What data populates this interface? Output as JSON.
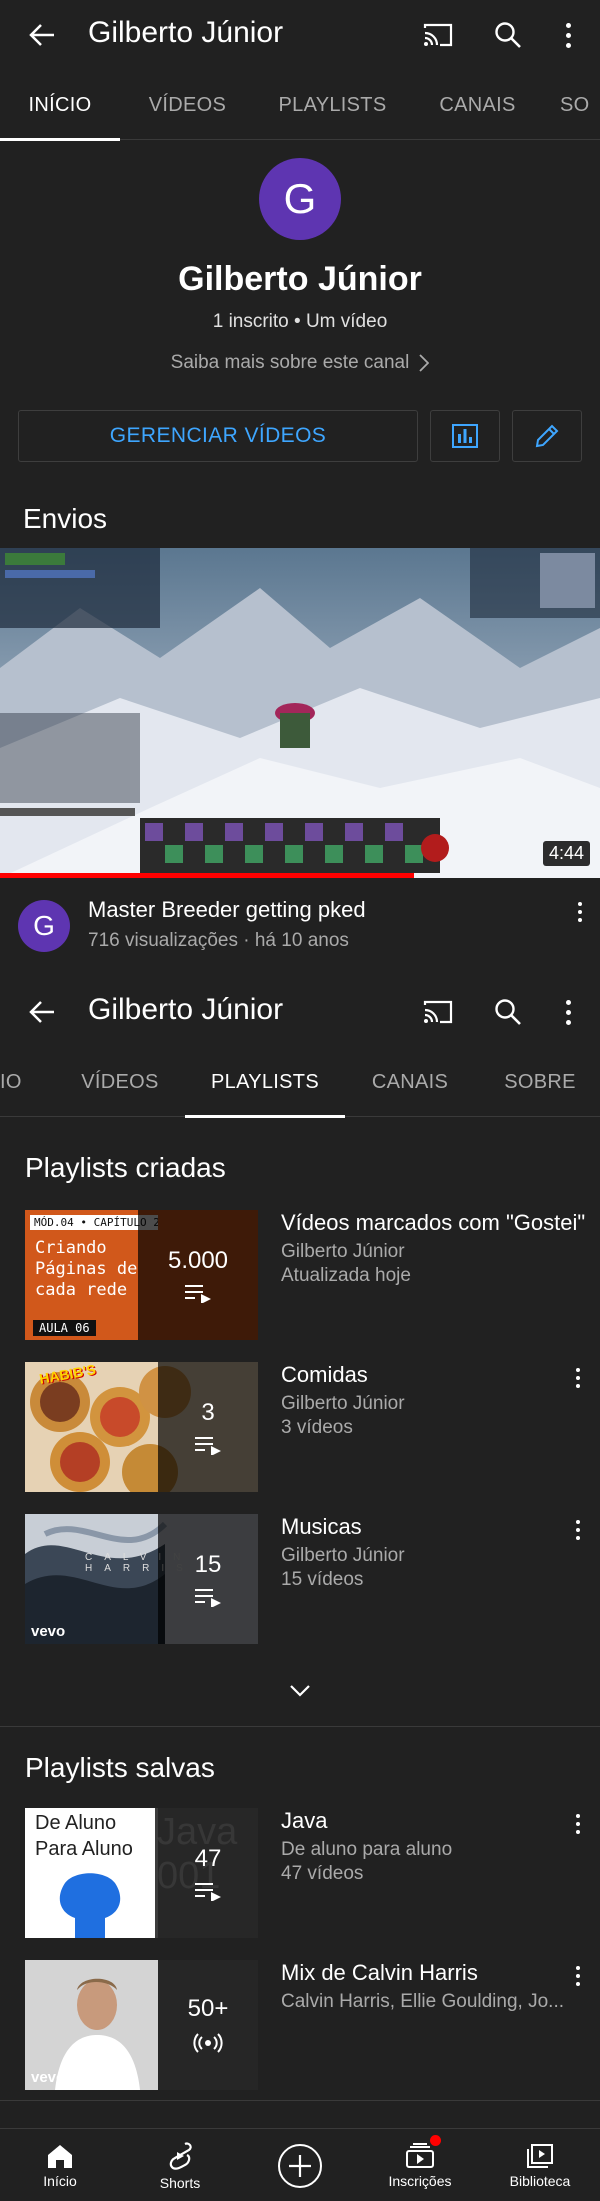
{
  "screen1": {
    "header": {
      "title": "Gilberto Júnior"
    },
    "tabs": [
      {
        "label": "INÍCIO",
        "active": true
      },
      {
        "label": "VÍDEOS",
        "active": false
      },
      {
        "label": "PLAYLISTS",
        "active": false
      },
      {
        "label": "CANAIS",
        "active": false
      },
      {
        "label": "SO",
        "active": false
      }
    ],
    "channel": {
      "avatar_letter": "G",
      "name": "Gilberto Júnior",
      "stats": "1 inscrito • Um vídeo",
      "more_link": "Saiba mais sobre este canal"
    },
    "manage_button": "GERENCIAR VÍDEOS",
    "uploads": {
      "heading": "Envios",
      "video": {
        "duration": "4:44",
        "title": "Master Breeder getting pked",
        "meta": "716 visualizações · há 10 anos",
        "avatar_letter": "G",
        "watched_fraction": 0.69
      }
    }
  },
  "screen2": {
    "header": {
      "title": "Gilberto Júnior"
    },
    "tabs": [
      {
        "label": "IO",
        "active": false
      },
      {
        "label": "VÍDEOS",
        "active": false
      },
      {
        "label": "PLAYLISTS",
        "active": true
      },
      {
        "label": "CANAIS",
        "active": false
      },
      {
        "label": "SOBRE",
        "active": false
      }
    ],
    "created": {
      "heading": "Playlists criadas",
      "items": [
        {
          "title": "Vídeos marcados com \"Gostei\"",
          "owner": "Gilberto Júnior",
          "detail": "Atualizada hoje",
          "count": "5.000",
          "thumb": {
            "badge": "MÓD.04 • CAPÍTULO 2",
            "line1": "Criando",
            "line2": "Páginas de",
            "line3": "cada rede",
            "footer": "AULA 06"
          }
        },
        {
          "title": "Comidas",
          "owner": "Gilberto Júnior",
          "detail": "3 vídeos",
          "count": "3",
          "thumb": {
            "brand": "HABIB'S"
          }
        },
        {
          "title": "Musicas",
          "owner": "Gilberto Júnior",
          "detail": "15 vídeos",
          "count": "15",
          "thumb": {
            "text": "CALVIN HARRIS",
            "logo": "vevo"
          }
        }
      ]
    },
    "saved": {
      "heading": "Playlists salvas",
      "items": [
        {
          "title": "Java",
          "owner": "De aluno para aluno",
          "detail": "47 vídeos",
          "count": "47",
          "thumb": {
            "line1": "De Aluno",
            "line2": "Para Aluno",
            "bg_text1": "Java",
            "bg_text2": "001"
          }
        },
        {
          "title": "Mix de Calvin Harris",
          "owner": "Calvin Harris, Ellie Goulding, Jo...",
          "count": "50+",
          "thumb": {
            "logo": "vevo"
          }
        }
      ]
    }
  },
  "bottom_nav": [
    {
      "label": "Início",
      "icon": "home-icon"
    },
    {
      "label": "Shorts",
      "icon": "shorts-icon"
    },
    {
      "label": "",
      "icon": "create-icon"
    },
    {
      "label": "Inscrições",
      "icon": "subscriptions-icon"
    },
    {
      "label": "Biblioteca",
      "icon": "library-icon"
    }
  ],
  "colors": {
    "background": "#212121",
    "accent_blue": "#3ea6ff",
    "avatar_purple": "#5e35b1",
    "red": "#ff0000"
  }
}
